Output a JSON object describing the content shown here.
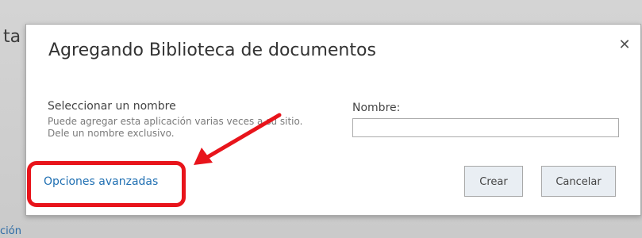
{
  "background": {
    "top_fragment": "ta",
    "bottom_fragment": "ción"
  },
  "dialog": {
    "title": "Agregando Biblioteca de documentos",
    "close_glyph": "✕",
    "section": {
      "heading": "Seleccionar un nombre",
      "description": "Puede agregar esta aplicación varias veces a su sitio. Dele un nombre exclusivo."
    },
    "name_field": {
      "label": "Nombre:",
      "value": "",
      "placeholder": ""
    },
    "advanced_link": "Opciones avanzadas",
    "buttons": {
      "create": "Crear",
      "cancel": "Cancelar"
    }
  },
  "annotation": {
    "color": "#e8141b"
  },
  "colors": {
    "link": "#1f6fb2",
    "overlay": "#c9c9c9",
    "button_bg": "#e9eef3"
  }
}
